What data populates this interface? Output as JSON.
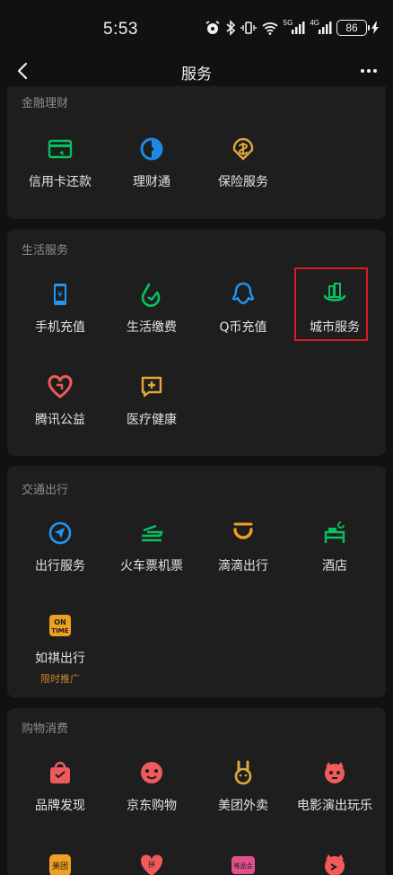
{
  "status_bar": {
    "time": "5:53",
    "battery": "86",
    "signal_label_1": "5G",
    "signal_label_2": "4G"
  },
  "nav": {
    "title": "服务"
  },
  "sections": {
    "finance": {
      "title": "金融理财",
      "items": [
        {
          "label": "信用卡还款",
          "icon": "credit-card-icon",
          "color": "#07c160"
        },
        {
          "label": "理财通",
          "icon": "wealth-icon",
          "color": "#1e88e5"
        },
        {
          "label": "保险服务",
          "icon": "insurance-icon",
          "color": "#e0a83a"
        }
      ]
    },
    "life": {
      "title": "生活服务",
      "items": [
        {
          "label": "手机充值",
          "icon": "phone-icon",
          "color": "#2196f3"
        },
        {
          "label": "生活缴费",
          "icon": "bill-icon",
          "color": "#07c160"
        },
        {
          "label": "Q币充值",
          "icon": "qq-penguin-icon",
          "color": "#2196f3"
        },
        {
          "label": "城市服务",
          "icon": "city-icon",
          "color": "#07c160"
        },
        {
          "label": "腾讯公益",
          "icon": "charity-heart-icon",
          "color": "#f05a5a"
        },
        {
          "label": "医疗健康",
          "icon": "medical-icon",
          "color": "#e0a83a"
        }
      ]
    },
    "transport": {
      "title": "交通出行",
      "items": [
        {
          "label": "出行服务",
          "icon": "travel-icon",
          "color": "#2196f3"
        },
        {
          "label": "火车票机票",
          "icon": "train-icon",
          "color": "#07c160"
        },
        {
          "label": "滴滴出行",
          "icon": "didi-icon",
          "color": "#f0a020"
        },
        {
          "label": "酒店",
          "icon": "hotel-icon",
          "color": "#07c160"
        },
        {
          "label": "如祺出行",
          "sublabel": "限时推广",
          "icon": "ontime-icon",
          "icon_text_1": "ON",
          "icon_text_2": "TIME",
          "color": "#f0a020"
        }
      ]
    },
    "shopping": {
      "title": "购物消费",
      "items": [
        {
          "label": "品牌发现",
          "icon": "brand-bag-icon",
          "color": "#f05a5a"
        },
        {
          "label": "京东购物",
          "icon": "jd-dog-icon",
          "color": "#f05a5a"
        },
        {
          "label": "美团外卖",
          "icon": "meituan-rabbit-icon",
          "color": "#e0a83a"
        },
        {
          "label": "电影演出玩乐",
          "icon": "maoyan-cat-icon",
          "color": "#f05a5a"
        },
        {
          "label": "",
          "icon": "meituan-icon",
          "icon_text": "美团",
          "color": "#f0a020"
        },
        {
          "label": "",
          "icon": "pinduoduo-icon",
          "icon_text": "拼",
          "color": "#f05a5a"
        },
        {
          "label": "",
          "icon": "vip-shop-icon",
          "icon_text": "唯品会",
          "color": "#e0508a"
        },
        {
          "label": "",
          "icon": "beike-icon",
          "color": "#f05a5a"
        }
      ]
    }
  }
}
